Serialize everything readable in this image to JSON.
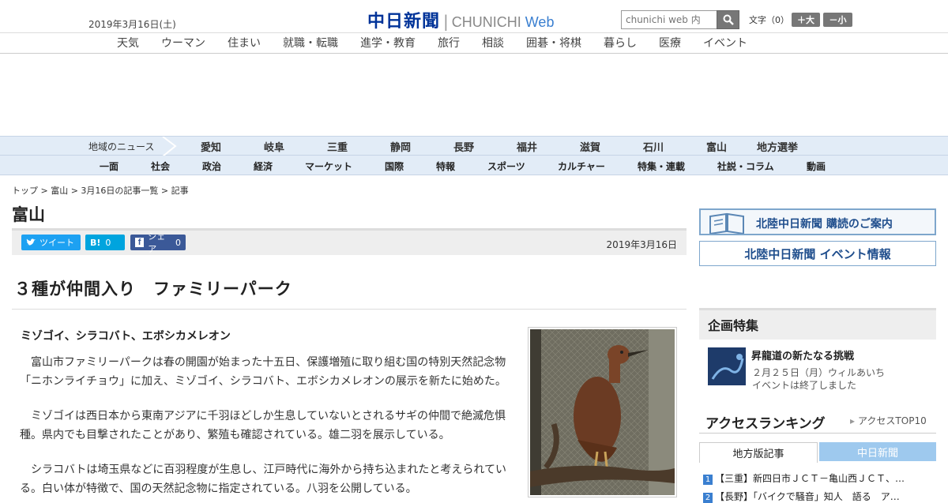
{
  "header": {
    "date": "2019年3月16日(土)",
    "logo_ja": "中日新聞",
    "logo_en": "CHUNICHI",
    "logo_web": "Web",
    "search_placeholder": "chunichi web 内",
    "fontsize_label": "文字（0）",
    "bigger_label": "＋大",
    "smaller_label": "－小"
  },
  "category_nav": [
    "天気",
    "ウーマン",
    "住まい",
    "就職・転職",
    "進学・教育",
    "旅行",
    "相談",
    "囲碁・将棋",
    "暮らし",
    "医療",
    "イベント"
  ],
  "region_nav": {
    "label": "地域のニュース",
    "items": [
      "愛知",
      "岐阜",
      "三重",
      "静岡",
      "長野",
      "福井",
      "滋賀",
      "石川",
      "富山",
      "地方選挙"
    ]
  },
  "main_nav": [
    "一面",
    "社会",
    "政治",
    "経済",
    "マーケット",
    "国際",
    "特報",
    "スポーツ",
    "カルチャー",
    "特集・連載",
    "社説・コラム",
    "動画"
  ],
  "breadcrumb": "トップ > 富山 > 3月16日の記事一覧 > 記事",
  "section_title": "富山",
  "share": {
    "tweet": "ツイート",
    "hatena": "B!",
    "hatena_count": "0",
    "facebook": "シェア",
    "facebook_count": "0"
  },
  "article": {
    "date": "2019年3月16日",
    "headline": "３種が仲間入り　ファミリーパーク",
    "subhead": "ミゾゴイ、シラコバト、エボシカメレオン",
    "paragraphs": [
      "富山市ファミリーパークは春の開園が始まった十五日、保護増殖に取り組む国の特別天然記念物「ニホンライチョウ」に加え、ミゾゴイ、シラコバト、エボシカメレオンの展示を新たに始めた。",
      "ミゾゴイは西日本から東南アジアに千羽ほどしか生息していないとされるサギの仲間で絶滅危惧種。県内でも目撃されたことがあり、繁殖も確認されている。雄二羽を展示している。",
      "シラコバトは埼玉県などに百羽程度が生息し、江戸時代に海外から持ち込まれたと考えられている。白い体が特徴で、国の天然記念物に指定されている。八羽を公開している。"
    ]
  },
  "sidebar": {
    "subscribe_label": "北陸中日新聞 購読のご案内",
    "events_label": "北陸中日新聞 イベント情報",
    "feature_heading": "企画特集",
    "feature_title": "昇龍道の新たなる挑戦",
    "feature_date": "２月２５日（月）ウィルあいち",
    "feature_note": "イベントは終了しました",
    "ranking_heading": "アクセスランキング",
    "ranking_link": "アクセスTOP10",
    "tab_local": "地方版記事",
    "tab_chunichi": "中日新聞",
    "ranking": [
      {
        "rank": "1",
        "text": "【三重】新四日市ＪＣＴ－亀山西ＪＣＴ、…"
      },
      {
        "rank": "2",
        "text": "【長野】「バイクで騒音」知人　語る　ア…"
      }
    ]
  },
  "colors": {
    "brand": "#003399",
    "nav_bg": "#e2ecf7",
    "twitter": "#1da1f2",
    "hatena": "#00a4de",
    "facebook": "#3b5998",
    "tab_active": "#9ec9ee"
  }
}
